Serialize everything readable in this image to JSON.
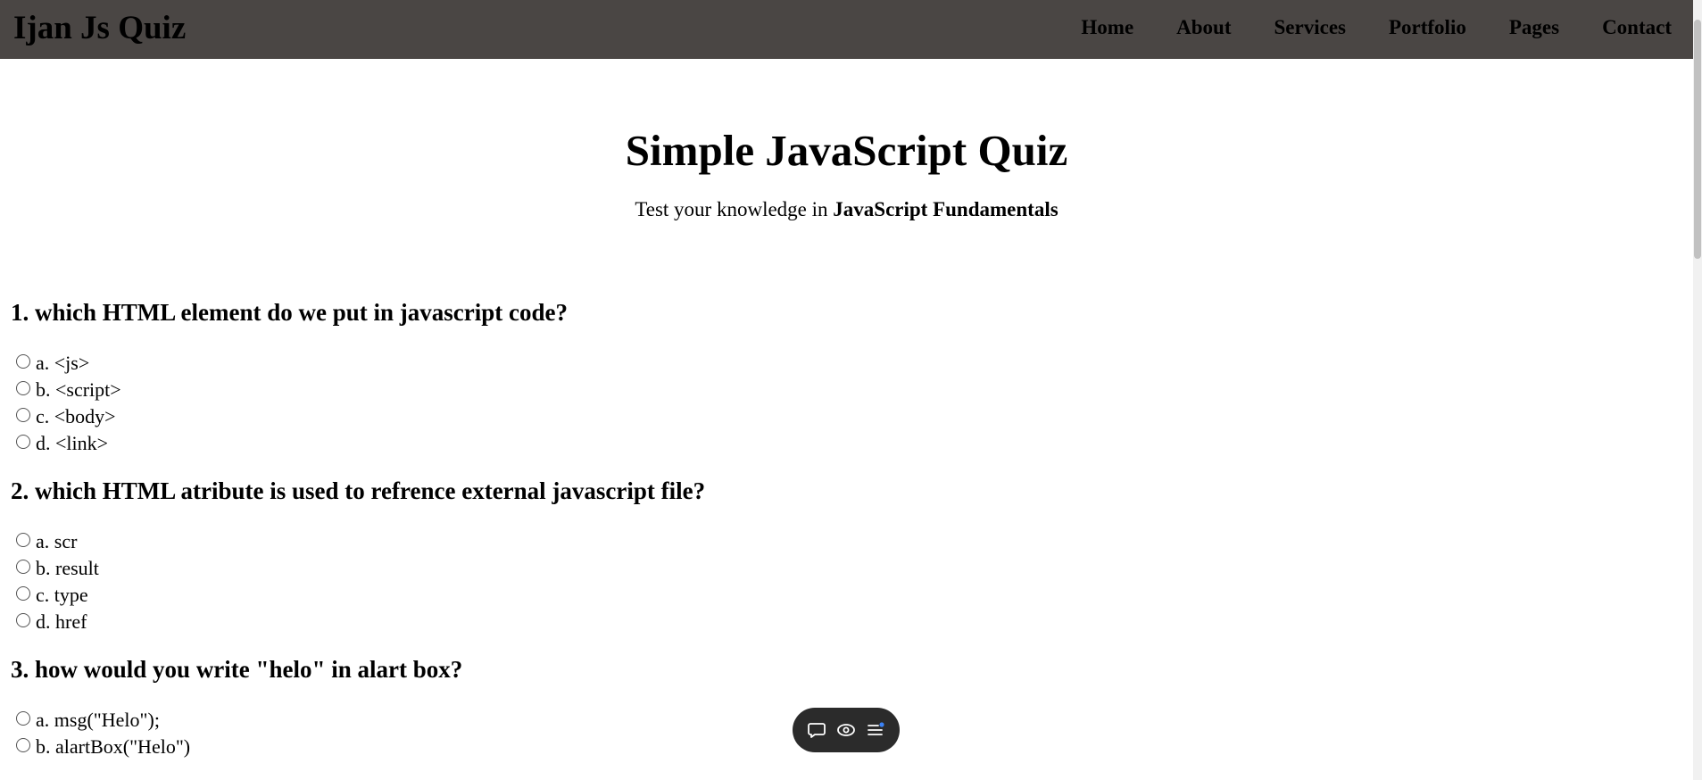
{
  "header": {
    "brand": "Ijan Js Quiz",
    "nav": [
      "Home",
      "About",
      "Services",
      "Portfolio",
      "Pages",
      "Contact"
    ]
  },
  "hero": {
    "title": "Simple JavaScript Quiz",
    "subtitle_prefix": "Test your knowledge in ",
    "subtitle_bold": "JavaScript Fundamentals"
  },
  "questions": [
    {
      "text": "1. which HTML element do we put in javascript code?",
      "options": [
        "a. <js>",
        "b. <script>",
        "c. <body>",
        "d. <link>"
      ]
    },
    {
      "text": "2. which HTML atribute is used to refrence external javascript file?",
      "options": [
        "a. scr",
        "b. result",
        "c. type",
        "d. href"
      ]
    },
    {
      "text": "3. how would you write \"helo\" in alart box?",
      "options": [
        "a. msg(\"Helo\");",
        "b. alartBox(\"Helo\")"
      ]
    }
  ],
  "float_toolbar": {
    "icons": [
      "chat-bubble-icon",
      "eye-icon",
      "menu-list-icon"
    ],
    "accent": "#3b82f6"
  },
  "colors": {
    "header_bg": "#4a4644",
    "toolbar_bg": "#2b2b2b"
  }
}
